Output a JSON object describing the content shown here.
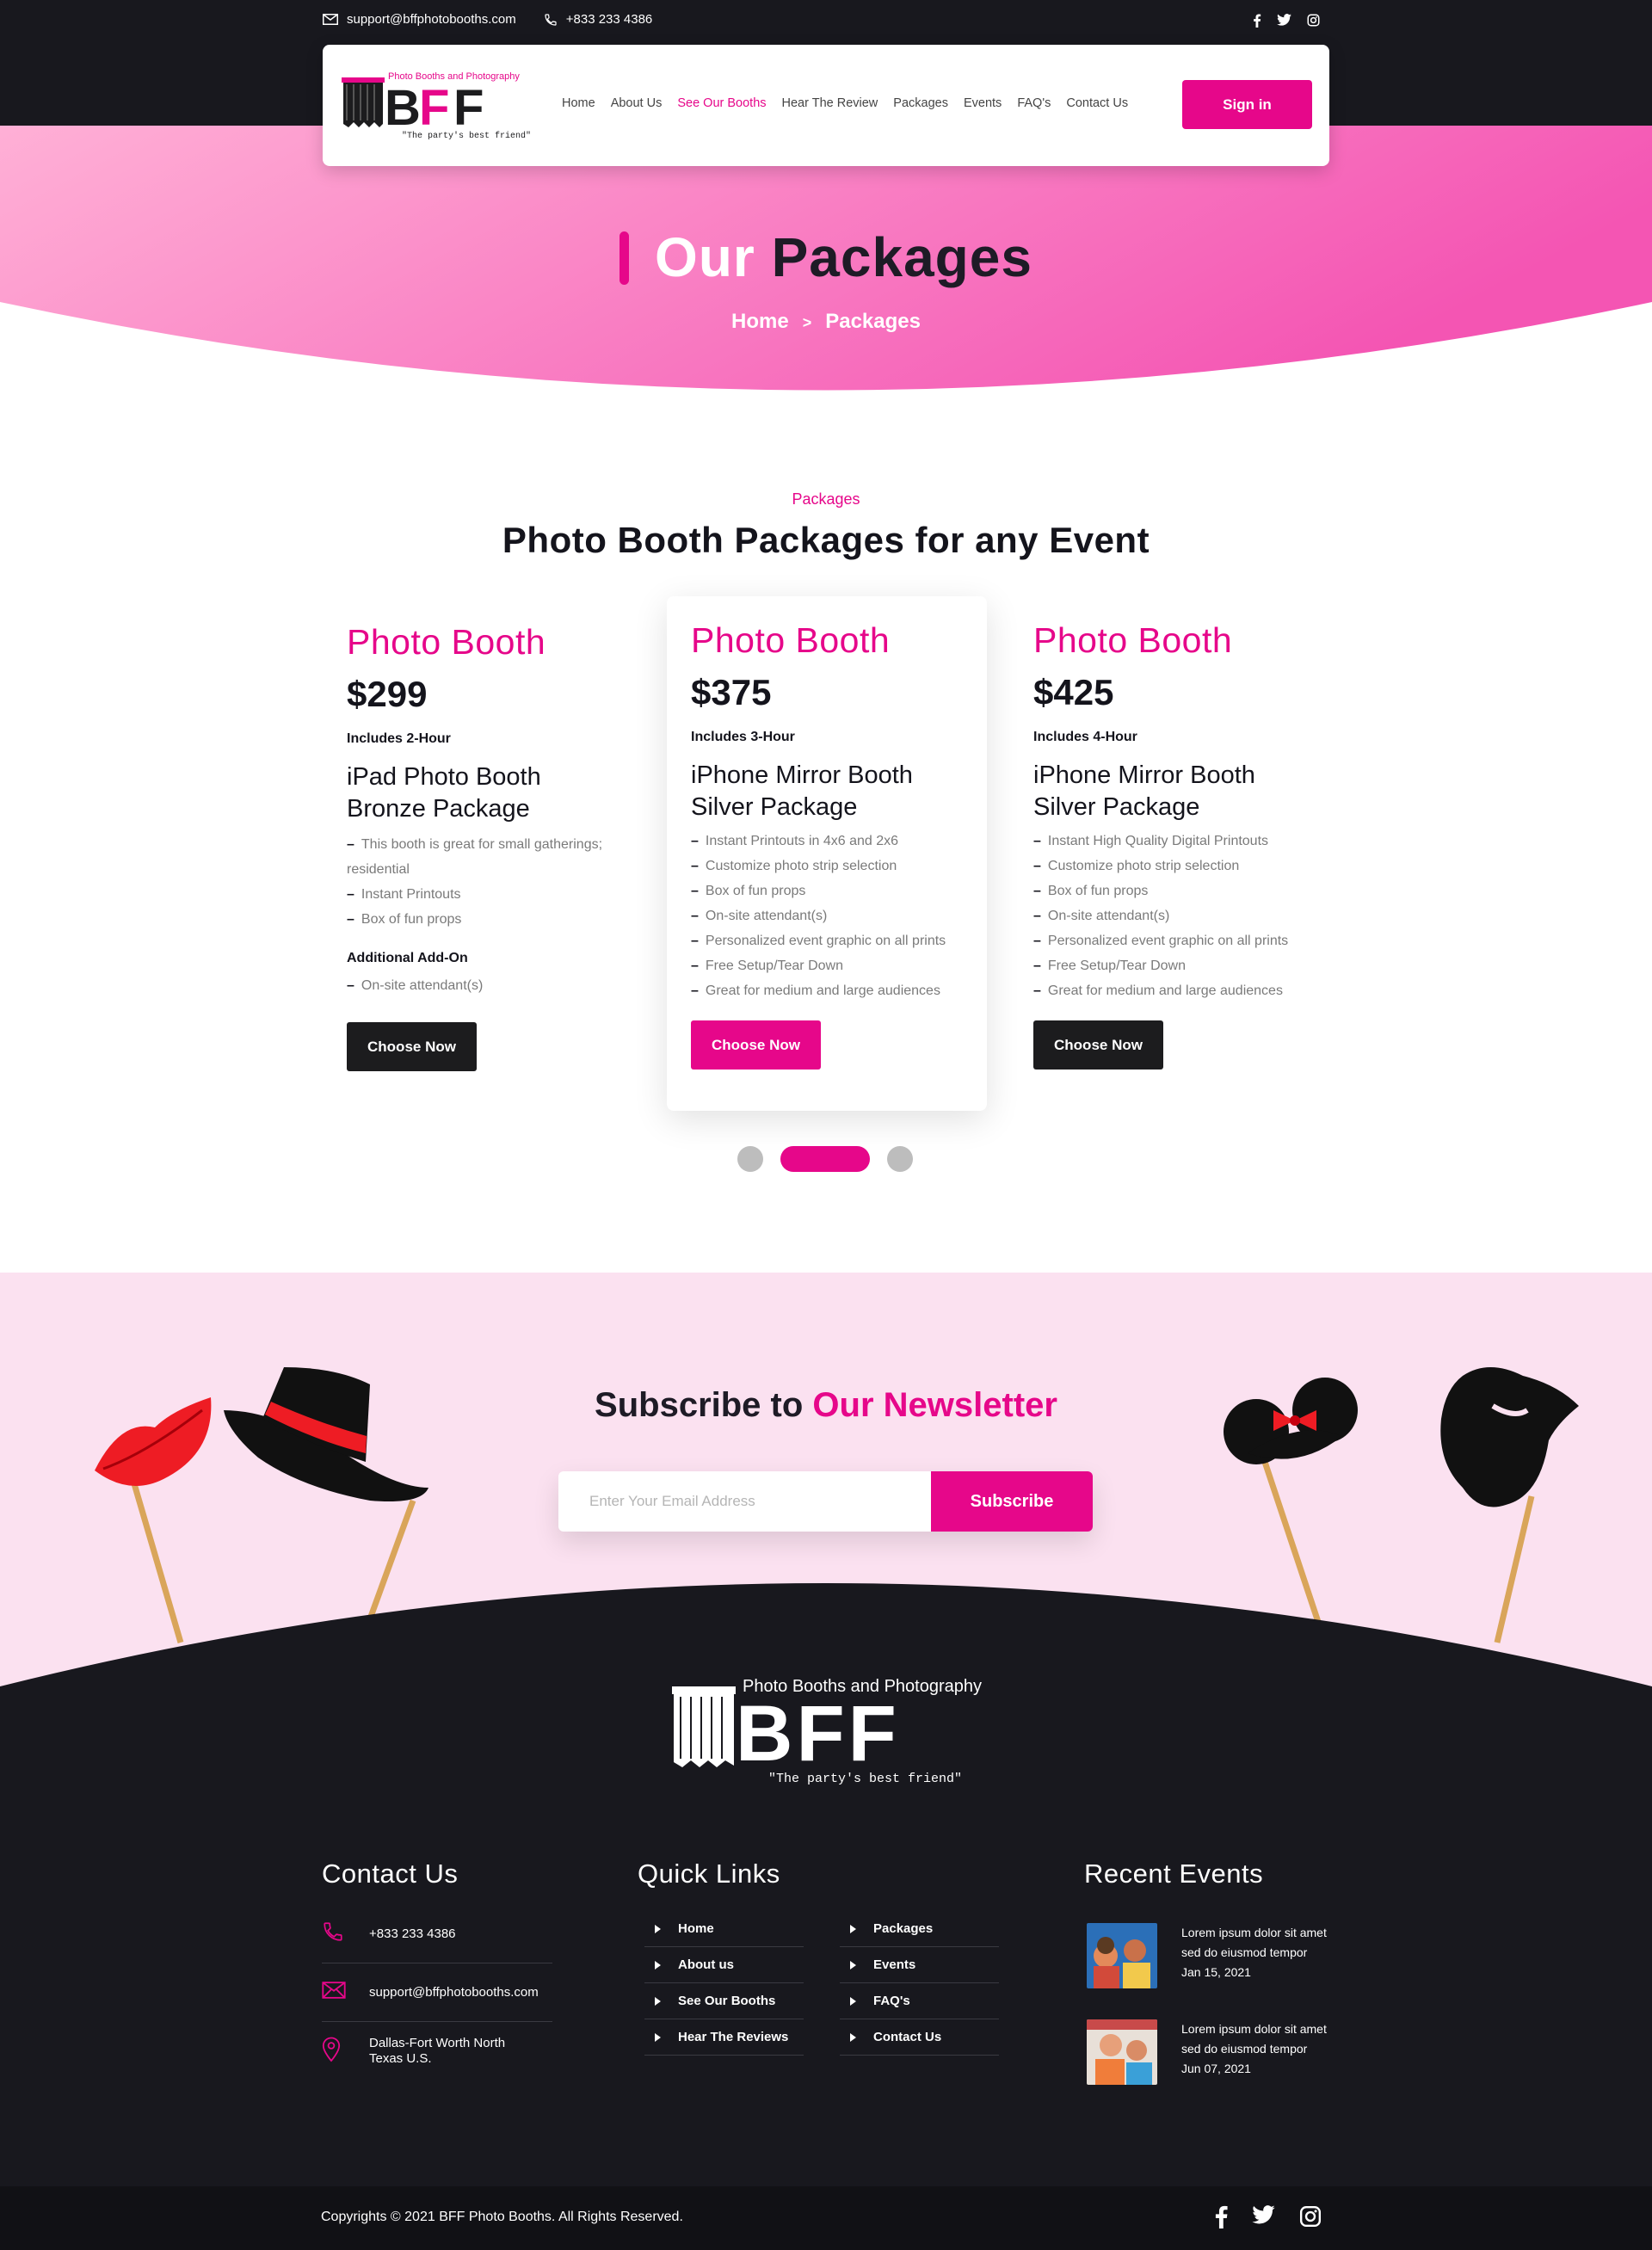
{
  "topbar": {
    "email": "support@bffphotobooths.com",
    "phone": "+833 233 4386",
    "social": [
      "facebook-icon",
      "twitter-icon",
      "instagram-icon"
    ]
  },
  "brand": {
    "tagline_top": "Photo Booths and Photography",
    "logo_text": "BFF",
    "tagline_bottom": "\"The party's best friend\""
  },
  "nav": {
    "items": [
      "Home",
      "About Us",
      "See Our Booths",
      "Hear The Review",
      "Packages",
      "Events",
      "FAQ's",
      "Contact Us"
    ],
    "active_index": 2,
    "signin": "Sign in"
  },
  "hero": {
    "title_word1": "Our",
    "title_word2": "Packages",
    "breadcrumb": [
      "Home",
      ">",
      "Packages"
    ]
  },
  "packages": {
    "label": "Packages",
    "title": "Photo Booth Packages for any Event",
    "cards": [
      {
        "title": "Photo Booth",
        "price": "$299",
        "includes": "Includes 2-Hour",
        "name_line1": "iPad Photo Booth",
        "name_line2": "Bronze Package",
        "features": [
          "This booth is great for small gatherings; residential",
          "Instant Printouts",
          "Box of fun props"
        ],
        "addon_title": "Additional Add-On",
        "addon_items": [
          "On-site attendant(s)"
        ],
        "button": "Choose Now"
      },
      {
        "title": "Photo Booth",
        "price": "$375",
        "includes": "Includes 3-Hour",
        "name_line1": "iPhone Mirror Booth",
        "name_line2": "Silver Package",
        "features": [
          "Instant Printouts in 4x6 and 2x6",
          "Customize photo strip selection",
          "Box of fun props",
          "On-site attendant(s)",
          "Personalized event graphic on all prints",
          "Free Setup/Tear Down",
          "Great for medium and large audiences"
        ],
        "button": "Choose Now"
      },
      {
        "title": "Photo Booth",
        "price": "$425",
        "includes": "Includes 4-Hour",
        "name_line1": "iPhone Mirror Booth",
        "name_line2": "Silver Package",
        "features": [
          "Instant High Quality Digital Printouts",
          "Customize photo strip selection",
          "Box of fun props",
          "On-site attendant(s)",
          "Personalized event graphic on all prints",
          "Free Setup/Tear Down",
          "Great for medium and large audiences"
        ],
        "button": "Choose Now"
      }
    ],
    "carousel_active": 2
  },
  "newsletter": {
    "title_part1": "Subscribe to",
    "title_part2": "Our Newsletter",
    "placeholder": "Enter Your Email Address",
    "button": "Subscribe"
  },
  "footer": {
    "contact_title": "Contact Us",
    "phone": "+833 233 4386",
    "email": "support@bffphotobooths.com",
    "address_line1": "Dallas-Fort Worth North",
    "address_line2": "Texas U.S.",
    "links_title": "Quick Links",
    "links_col1": [
      "Home",
      "About us",
      "See Our Booths",
      "Hear The Reviews"
    ],
    "links_col2": [
      "Packages",
      "Events",
      "FAQ's",
      "Contact Us"
    ],
    "events_title": "Recent Events",
    "events": [
      {
        "line1": "Lorem ipsum dolor sit amet",
        "line2": "sed do eiusmod tempor",
        "date": "Jan 15, 2021"
      },
      {
        "line1": "Lorem ipsum dolor sit amet",
        "line2": "sed do eiusmod tempor",
        "date": "Jun 07, 2021"
      }
    ],
    "copyright": "Copyrights © 2021 BFF Photo Booths. All Rights Reserved."
  },
  "colors": {
    "accent": "#e6078a",
    "dark": "#18181e",
    "hero_gradient_start": "#ffb0d6",
    "hero_gradient_end": "#f455b3",
    "newsletter_bg": "#fbe1f0"
  }
}
